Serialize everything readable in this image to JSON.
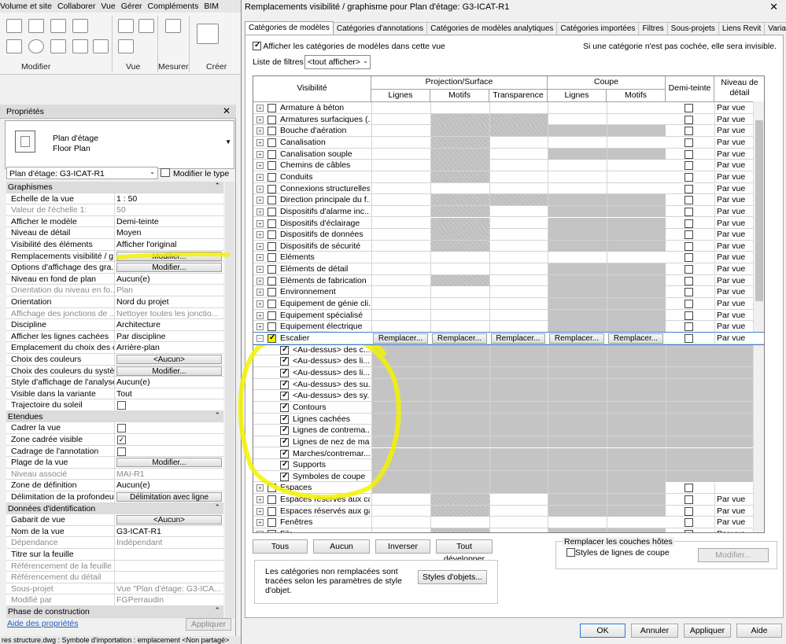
{
  "ribbon": {
    "tabs": [
      "Volume et site",
      "Collaborer",
      "Vue",
      "Gérer",
      "Compléments",
      "BIM"
    ],
    "groups": [
      "Modifier",
      "Vue",
      "Mesurer",
      "Créer"
    ]
  },
  "props": {
    "title": "Propriétés",
    "type_line1": "Plan d'étage",
    "type_line2": "Floor Plan",
    "instance": "Plan d'étage: G3-ICAT-R1",
    "edit_type": "Modifier le type",
    "rows": [
      {
        "kind": "sec",
        "name": "Graphismes"
      },
      {
        "name": "Echelle de la vue",
        "value": "1 : 50"
      },
      {
        "name": "Valeur de l'échelle    1:",
        "value": "50",
        "dis": true
      },
      {
        "name": "Afficher le modèle",
        "value": "Demi-teinte"
      },
      {
        "name": "Niveau de détail",
        "value": "Moyen"
      },
      {
        "name": "Visibilité des éléments",
        "value": "Afficher l'original"
      },
      {
        "name": "Remplacements visibilité / g...",
        "button": "Modifier..."
      },
      {
        "name": "Options d'affichage des gra...",
        "button": "Modifier..."
      },
      {
        "name": "Niveau en fond de plan",
        "value": "Aucun(e)"
      },
      {
        "name": "Orientation du niveau en fo...",
        "value": "Plan",
        "dis": true
      },
      {
        "name": "Orientation",
        "value": "Nord du projet"
      },
      {
        "name": "Affichage des jonctions de ...",
        "value": "Nettoyer toutes les jonctio...",
        "dis": true
      },
      {
        "name": "Discipline",
        "value": "Architecture"
      },
      {
        "name": "Afficher les lignes cachées",
        "value": "Par discipline"
      },
      {
        "name": "Emplacement du choix des c...",
        "value": "Arrière-plan"
      },
      {
        "name": "Choix des couleurs",
        "button": "<Aucun>"
      },
      {
        "name": "Choix des couleurs du systè...",
        "button": "Modifier..."
      },
      {
        "name": "Style d'affichage de l'analyse...",
        "value": "Aucun(e)"
      },
      {
        "name": "Visible dans la variante",
        "value": "Tout"
      },
      {
        "name": "Trajectoire du soleil",
        "check": false
      },
      {
        "kind": "sec",
        "name": "Etendues"
      },
      {
        "name": "Cadrer la vue",
        "check": false
      },
      {
        "name": "Zone cadrée visible",
        "check": true
      },
      {
        "name": "Cadrage de l'annotation",
        "check": false
      },
      {
        "name": "Plage de la vue",
        "button": "Modifier..."
      },
      {
        "name": "Niveau associé",
        "value": "MAI-R1",
        "dis": true
      },
      {
        "name": "Zone de définition",
        "value": "Aucun(e)"
      },
      {
        "name": "Délimitation de la profondeur",
        "button": "Délimitation avec ligne"
      },
      {
        "kind": "sec",
        "name": "Données d'identification"
      },
      {
        "name": "Gabarit de vue",
        "button": "<Aucun>"
      },
      {
        "name": "Nom de la vue",
        "value": "G3-ICAT-R1"
      },
      {
        "name": "Dépendance",
        "value": "Indépendant",
        "dis": true
      },
      {
        "name": "Titre sur la feuille",
        "value": ""
      },
      {
        "name": "Référencement de la feuille",
        "value": "",
        "dis": true
      },
      {
        "name": "Référencement du détail",
        "value": "",
        "dis": true
      },
      {
        "name": "Sous-projet",
        "value": "Vue \"Plan d'étage: G3-ICA...",
        "dis": true
      },
      {
        "name": "Modifié par",
        "value": "FGPerraudin",
        "dis": true
      },
      {
        "kind": "sec",
        "name": "Phase de construction"
      }
    ],
    "help": "Aide des propriétés",
    "apply": "Appliquer"
  },
  "status": "res structure.dwg : Symbole d'importation : emplacement <Non partagé>",
  "dialog": {
    "title": "Remplacements visibilité / graphisme pour Plan d'étage: G3-ICAT-R1",
    "tabs": [
      "Catégories de modèles",
      "Catégories d'annotations",
      "Catégories de modèles analytiques",
      "Catégories importées",
      "Filtres",
      "Sous-projets",
      "Liens Revit",
      "Variantes"
    ],
    "show_cats": "Afficher les catégories de modèles dans cette vue",
    "hint": "Si une catégorie n'est pas cochée, elle sera invisible.",
    "filter_label": "Liste de filtres:",
    "filter_value": "<tout afficher>",
    "headers": {
      "visibility": "Visibilité",
      "projection": "Projection/Surface",
      "cut": "Coupe",
      "lines": "Lignes",
      "patterns": "Motifs",
      "transparency": "Transparence",
      "halftone": "Demi-teinte",
      "detail1": "Niveau de",
      "detail2": "détail"
    },
    "override_btn": "Remplacer...",
    "rows": [
      {
        "name": "Armature à béton",
        "lvl": "Par vue",
        "g": [
          0,
          0,
          0,
          0,
          0
        ]
      },
      {
        "name": "Armatures surfaciques (...",
        "lvl": "Par vue",
        "g": [
          0,
          2,
          2,
          0,
          0
        ]
      },
      {
        "name": "Bouche d'aération",
        "lvl": "Par vue",
        "g": [
          0,
          2,
          2,
          1,
          1
        ]
      },
      {
        "name": "Canalisation",
        "lvl": "Par vue",
        "g": [
          0,
          2,
          0,
          0,
          0
        ]
      },
      {
        "name": "Canalisation souple",
        "lvl": "Par vue",
        "g": [
          0,
          2,
          0,
          1,
          1
        ]
      },
      {
        "name": "Chemins de câbles",
        "lvl": "Par vue",
        "g": [
          0,
          2,
          0,
          0,
          0
        ]
      },
      {
        "name": "Conduits",
        "lvl": "Par vue",
        "g": [
          0,
          2,
          0,
          0,
          0
        ]
      },
      {
        "name": "Connexions structurelles",
        "lvl": "Par vue",
        "g": [
          0,
          0,
          0,
          0,
          0
        ]
      },
      {
        "name": "Direction principale du f...",
        "lvl": "Par vue",
        "g": [
          0,
          2,
          2,
          1,
          1
        ]
      },
      {
        "name": "Dispositifs d'alarme inc...",
        "lvl": "Par vue",
        "g": [
          0,
          2,
          0,
          1,
          1
        ]
      },
      {
        "name": "Dispositifs d'éclairage",
        "lvl": "Par vue",
        "g": [
          0,
          2,
          0,
          1,
          1
        ]
      },
      {
        "name": "Dispositifs de données",
        "lvl": "Par vue",
        "g": [
          0,
          2,
          0,
          1,
          1
        ]
      },
      {
        "name": "Dispositifs de sécurité",
        "lvl": "Par vue",
        "g": [
          0,
          2,
          0,
          1,
          1
        ]
      },
      {
        "name": "Eléments",
        "lvl": "Par vue",
        "g": [
          0,
          0,
          0,
          0,
          0
        ]
      },
      {
        "name": "Eléments de détail",
        "lvl": "Par vue",
        "g": [
          0,
          0,
          0,
          1,
          1
        ]
      },
      {
        "name": "Eléments de fabrication",
        "lvl": "Par vue",
        "g": [
          0,
          2,
          0,
          1,
          1
        ]
      },
      {
        "name": "Environnement",
        "lvl": "Par vue",
        "g": [
          0,
          0,
          0,
          1,
          1
        ]
      },
      {
        "name": "Equipement de génie cli...",
        "lvl": "Par vue",
        "g": [
          0,
          0,
          0,
          1,
          1
        ]
      },
      {
        "name": "Equipement spécialisé",
        "lvl": "Par vue",
        "g": [
          0,
          0,
          0,
          1,
          1
        ]
      },
      {
        "name": "Equipement électrique",
        "lvl": "Par vue",
        "g": [
          0,
          0,
          0,
          1,
          1
        ]
      },
      {
        "name": "Escalier",
        "lvl": "Par vue",
        "sel": true
      },
      {
        "name": "<Au-dessus> des c...",
        "sub": true
      },
      {
        "name": "<Au-dessus> des li...",
        "sub": true
      },
      {
        "name": "<Au-dessus> des li...",
        "sub": true
      },
      {
        "name": "<Au-dessus> des su...",
        "sub": true
      },
      {
        "name": "<Au-dessus> des sy...",
        "sub": true
      },
      {
        "name": "Contours",
        "sub": true
      },
      {
        "name": "Lignes cachées",
        "sub": true
      },
      {
        "name": "Lignes de contrema...",
        "sub": true
      },
      {
        "name": "Lignes de nez de ma...",
        "sub": true
      },
      {
        "name": "Marches/contremar...",
        "sub": true
      },
      {
        "name": "Supports",
        "sub": true
      },
      {
        "name": "Symboles de coupe",
        "sub": true
      },
      {
        "name": "Espaces",
        "lvl": "",
        "g": [
          1,
          1,
          1,
          1,
          1
        ]
      },
      {
        "name": "Espaces réservés aux ca...",
        "lvl": "Par vue",
        "g": [
          0,
          2,
          0,
          1,
          1
        ]
      },
      {
        "name": "Espaces réservés aux gai...",
        "lvl": "Par vue",
        "g": [
          0,
          2,
          0,
          1,
          1
        ]
      },
      {
        "name": "Fenêtres",
        "lvl": "Par vue",
        "g": [
          0,
          0,
          0,
          0,
          0
        ]
      },
      {
        "name": "Fils",
        "lvl": "Par vue",
        "g": [
          0,
          2,
          0,
          1,
          1
        ]
      }
    ],
    "buttons": {
      "all": "Tous",
      "none": "Aucun",
      "invert": "Inverser",
      "expand": "Tout développer",
      "host_title": "Remplacer les couches hôtes",
      "cut_styles": "Styles de lignes de coupe",
      "modify": "Modifier...",
      "note": "Les catégories non remplacées sont tracées selon les paramètres de style d'objet.",
      "obj_styles": "Styles d'objets...",
      "ok": "OK",
      "cancel": "Annuler",
      "apply": "Appliquer",
      "help": "Aide"
    }
  }
}
